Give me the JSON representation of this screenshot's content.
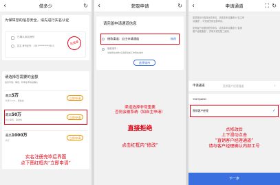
{
  "panel1": {
    "title": "借多少",
    "identity_heading": "为保障您的信息安全，请先进行实名认证",
    "identity_small_text": "已确认添加身份",
    "identity_sub": "姓名  身份证号：1367*********5615",
    "verified_stamp": "已完成",
    "amount_heading": "请选择您需要的金额",
    "amount_sub": "最高可借，审批，利率在申请后确认",
    "offers": [
      {
        "label": "最高",
        "amount": "5万",
        "sub": "利率 0.5%，审批快",
        "button": "立即申请"
      },
      {
        "label": "最高",
        "amount": "50万",
        "sub": "线上审核，审批快",
        "button": "立即申请"
      },
      {
        "label": "最高",
        "amount": "1000万",
        "sub": "线下",
        "button": "立即申请"
      }
    ],
    "annotation": "实名注册完毕后界面\n点下图红框内“立即申请”"
  },
  "panel2": {
    "title": "获取申请",
    "box_heading": "请完善申请通道信息",
    "channel_label": "借款渠道：自主申请通道",
    "modify": "修改",
    "city_text": "借款城市：",
    "city_hint": "当前所在城市/请选择当前工作所在城市",
    "select_city": "选择城市",
    "annotation_small": "渠道选择非常重要\n否则会被系统（如自主申请）",
    "annotation_big": "直接拒绝",
    "annotation_bottom": "点击红框内“修改”"
  },
  "panel3": {
    "title": "申请通道",
    "intro_lines": [
      "如您是自行选择业务申请，请选择申请通道为“自主申",
      "请通道”，可快速完成全部申请。",
      "",
      "如有客户经理协助您申请，请选择申请通道为“直销",
      "客户经理通道”，并填写或扫描二维码。"
    ],
    "channel_row_label": "申请通道",
    "channel_row_value": "直销客户经理通道",
    "name_label": "YUEQIANG",
    "direct_label": "直销客户经理",
    "annotation": "点修改后\n上下滑动点击\n“直销客户经理通道”\n请与客户经理确认内部工号",
    "next_button": "下一步"
  }
}
